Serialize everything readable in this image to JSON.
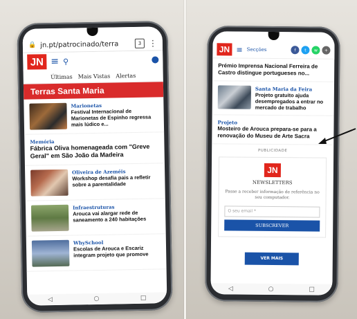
{
  "left_phone": {
    "url": "jn.pt/patrocinado/terra",
    "tab_count": "3",
    "tabs": [
      "Últimas",
      "Mais Vistas",
      "Alertas"
    ],
    "section_title": "Terras Santa Maria",
    "logo_text": "JN",
    "items": [
      {
        "kicker": "Marionetas",
        "headline": "Festival Internacional de Marionetas de Espinho regressa mais lúdico e..."
      },
      {
        "kicker": "Memória",
        "headline": "Fábrica Oliva homenageada com \"Greve Geral\" em São João da Madeira"
      },
      {
        "kicker": "Oliveira de Azeméis",
        "headline": "Workshop desafia pais a refletir sobre a parentalidade"
      },
      {
        "kicker": "Infraestruturas",
        "headline": "Arouca vai alargar rede de saneamento a 240 habitações"
      },
      {
        "kicker": "WhySchool",
        "headline": "Escolas de Arouca e Escariz integram projeto que promove"
      }
    ]
  },
  "right_phone": {
    "logo_text": "JN",
    "sections_label": "Secções",
    "top_headline": "Prémio Imprensa Nacional Ferreira de Castro distingue portugueses no...",
    "items": [
      {
        "kicker": "Santa Maria da Feira",
        "headline": "Projeto gratuito ajuda desempregados a entrar no mercado de trabalho"
      }
    ],
    "project_kicker": "Projeto",
    "project_headline": "Mosteiro de Arouca prepara-se para a renovação do Museu de Arte Sacra",
    "publicidade": "PUBLICIDADE",
    "newsletter_title": "NEWSLETTERS",
    "newsletter_text": "Passe a receber informação de referência no seu computador.",
    "email_placeholder": "O seu email *",
    "subscribe_label": "SUBSCREVER",
    "more_label": "VER MAIS"
  },
  "colors": {
    "jn_red": "#e1261c",
    "jn_blue": "#1a53a8",
    "section_red": "#d92b2b",
    "facebook": "#3b5998",
    "twitter": "#1da1f2",
    "whatsapp": "#25d366",
    "grey": "#666666"
  },
  "icons": [
    "hamburger-icon",
    "search-icon",
    "user-icon",
    "more-icon",
    "back-icon",
    "home-icon",
    "recents-icon",
    "arrow-pointer-icon"
  ]
}
